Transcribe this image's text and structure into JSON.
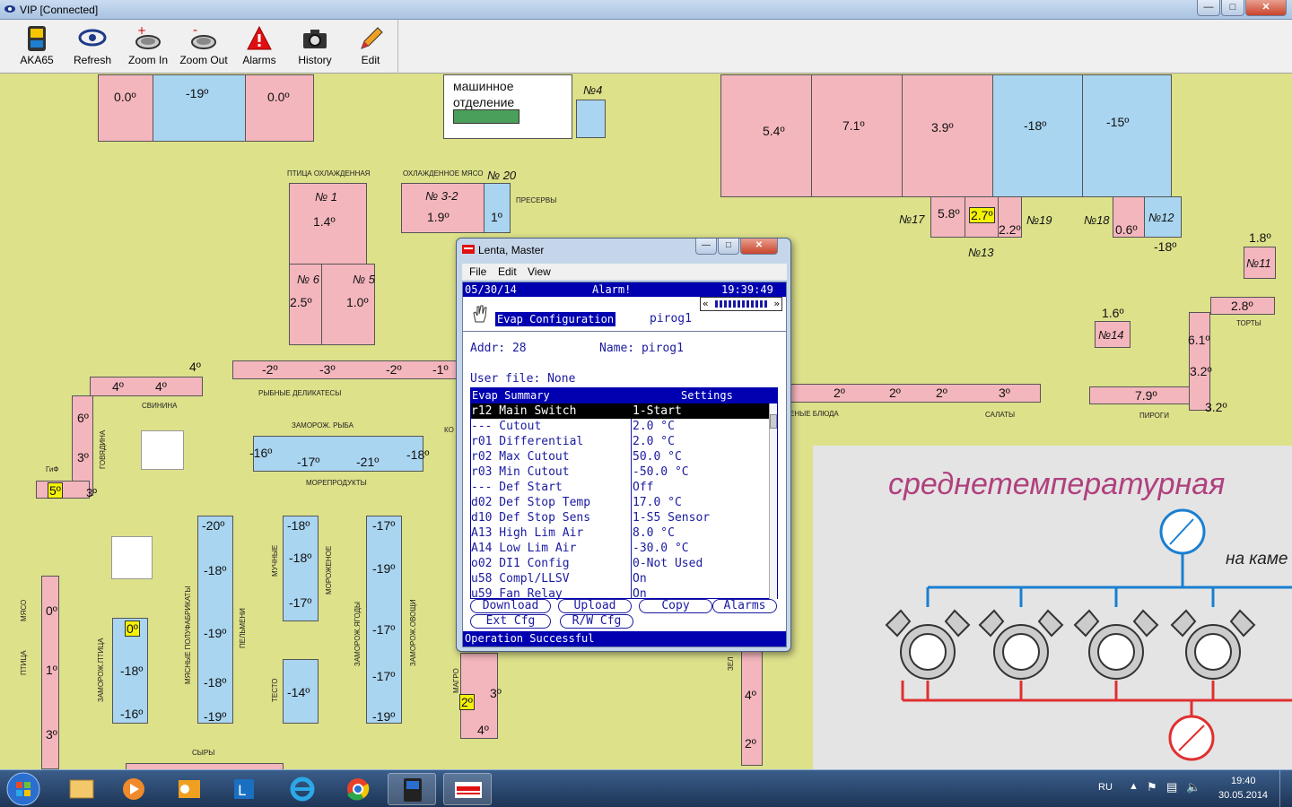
{
  "app": {
    "title": "VIP [Connected]"
  },
  "toolbar": {
    "items": [
      {
        "label": "AKA65",
        "icon": "device-icon"
      },
      {
        "label": "Refresh",
        "icon": "eye-icon"
      },
      {
        "label": "Zoom In",
        "icon": "zoom-in-icon"
      },
      {
        "label": "Zoom Out",
        "icon": "zoom-out-icon"
      },
      {
        "label": "Alarms",
        "icon": "warning-icon"
      },
      {
        "label": "History",
        "icon": "camera-icon"
      },
      {
        "label": "Edit",
        "icon": "pencil-icon"
      }
    ]
  },
  "map": {
    "machine_room": "машинное отделение",
    "top_left": {
      "a": "0.0º",
      "b": "-19º",
      "c": "0.0º"
    },
    "n4": "№4",
    "top_right": {
      "a": "5.4º",
      "b": "7.1º",
      "c": "3.9º",
      "d": "-18º",
      "e": "-15º"
    },
    "r17": {
      "label": "№17",
      "v1": "5.8º",
      "v2": "2.7º",
      "v3": "2.2º",
      "n19": "№19",
      "n13": "№13"
    },
    "r18": {
      "label": "№18",
      "v": "0.6º",
      "n12": "№12",
      "v2": "-18º"
    },
    "n11": {
      "v": "1.8º",
      "label": "№11"
    },
    "n14": {
      "v": "1.6º",
      "label": "№14"
    },
    "torty": {
      "v": "2.8º",
      "label": "ТОРТЫ"
    },
    "labels": {
      "ptitsa": "ПТИЦА ОХЛАЖДЕННАЯ",
      "myaso": "ОХЛАЖДЕННОЕ МЯСО",
      "preservy": "ПРЕСЕРВЫ",
      "n20": "№ 20",
      "ryba": "РЫБНЫЕ ДЕЛИКАТЕСЫ",
      "svinina": "СВИНИНА",
      "zamoroz_ryba": "ЗАМОРОЖ. РЫБА",
      "moreprodukty": "МОРЕПРОДУКТЫ",
      "gotovye": "ЕНЫЕ БЛЮДА",
      "salaty": "САЛАТЫ",
      "pirogi": "ПИРОГИ",
      "syry": "СЫРЫ",
      "gf": "ГиФ",
      "kondit": "КО"
    },
    "n1": {
      "label": "№ 1",
      "v": "1.4º"
    },
    "n32": {
      "label": "№ 3-2",
      "v": "1.9º",
      "v2": "1º"
    },
    "n6": {
      "label": "№ 6",
      "v": "2.5º"
    },
    "n5": {
      "label": "№ 5",
      "v": "1.0º"
    },
    "ryba_row": [
      "-2º",
      "-3º",
      "-2º",
      "-1º"
    ],
    "svin": [
      "4º",
      "4º"
    ],
    "svin_edge": "4º",
    "left_col": [
      "6º",
      "3º"
    ],
    "gf": {
      "v": "5º",
      "v2": "3º"
    },
    "zam_ryba": {
      "a": "-16º",
      "b": "-17º",
      "c": "-21º",
      "d": "-18º"
    },
    "salaty_row": [
      "2º",
      "2º",
      "2º",
      "3º"
    ],
    "pirogi": {
      "v": "7.9º",
      "v2": "3.2º"
    },
    "right_col": [
      "6.1º",
      "3.2º"
    ],
    "freezer1": [
      "-20º",
      "-18º",
      "-19º",
      "-18º",
      "-19º"
    ],
    "freezer2": [
      "-18º",
      "-18º",
      "-17º"
    ],
    "freezer3": [
      "-17º",
      "-19º",
      "-17º",
      "-17º",
      "-19º"
    ],
    "freezer_ptitsa": {
      "top": "0º",
      "mid": "-18º",
      "bot": "-16º"
    },
    "testo": "-14º",
    "left_strip": [
      "0º",
      "1º",
      "3º"
    ],
    "magro": {
      "a": "2º",
      "b": "3º",
      "c": "4º"
    },
    "right_strip": [
      "4º",
      "2º"
    ],
    "vertical_labels": {
      "myaso": "МЯСО",
      "ptitsa": "ПТИЦА",
      "zam_ptitsa": "ЗАМОРОЖ.ПТИЦА",
      "myasnye": "МЯСНЫЕ ПОЛУФАБРИКАТЫ",
      "pelmeni": "ПЕЛЬМЕНИ",
      "muchnye": "МУЧНЫЕ",
      "morozhenoe": "МОРОЖЕНОЕ",
      "testo": "ТЕСТО",
      "zam_yagody": "ЗАМОРОЖ.ЯГОДЫ",
      "zam_ovoshchi": "ЗАМОРОЖ.ОВОЩИ",
      "govyadina": "ГОВЯДИНА",
      "magro": "МАГРО",
      "zel": "ЗЕЛ"
    },
    "panel_title": "среднетемпературная",
    "panel_sub": "на каме"
  },
  "dialog": {
    "title": "Lenta, Master",
    "menu": [
      "File",
      "Edit",
      "View"
    ],
    "status_date": "05/30/14",
    "status_alarm": "Alarm!",
    "status_time": "19:39:49",
    "section": "Evap Configuration",
    "section_name": "pirog1",
    "addr_label": "Addr: 28",
    "name_label": "Name: pirog1",
    "user_file": "User file: None",
    "table_header": "Evap Summary",
    "table_header_right": "Settings",
    "rows": [
      {
        "param": "r12 Main Switch",
        "value": "1-Start",
        "selected": true
      },
      {
        "param": "--- Cutout",
        "value": "2.0 °C"
      },
      {
        "param": "r01 Differential",
        "value": "2.0 °C"
      },
      {
        "param": "r02 Max Cutout",
        "value": "50.0 °C"
      },
      {
        "param": "r03 Min Cutout",
        "value": "-50.0 °C"
      },
      {
        "param": "--- Def Start",
        "value": "Off"
      },
      {
        "param": "d02 Def Stop Temp",
        "value": "17.0 °C"
      },
      {
        "param": "d10 Def Stop Sens",
        "value": "1-S5 Sensor"
      },
      {
        "param": "A13 High Lim Air",
        "value": "8.0 °C"
      },
      {
        "param": "A14 Low Lim Air",
        "value": "-30.0 °C"
      },
      {
        "param": "o02 DI1 Config",
        "value": "0-Not Used"
      },
      {
        "param": "u58 Compl/LLSV",
        "value": "On"
      },
      {
        "param": "u59 Fan Relay",
        "value": "On"
      }
    ],
    "buttons": [
      "Download",
      "Upload",
      "Copy",
      "Alarms",
      "Ext Cfg",
      "R/W Cfg"
    ],
    "footer": "Operation Successful"
  },
  "taskbar": {
    "lang": "RU",
    "time": "19:40",
    "date": "30.05.2014"
  },
  "colors": {
    "pink": "#f4b6bd",
    "blue": "#a9d5f0",
    "field": "#dde18a",
    "accent": "#0000b0"
  }
}
